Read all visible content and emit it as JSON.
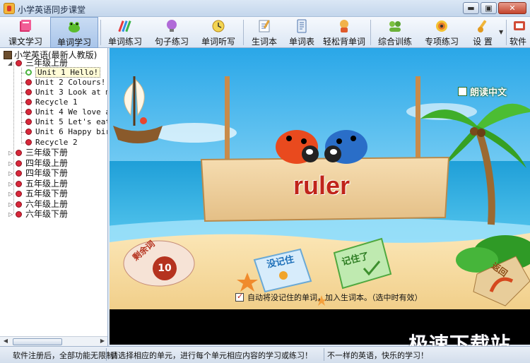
{
  "window": {
    "title": "小学英语同步课堂",
    "buttons": {
      "minimize": "▬",
      "maximize": "▣",
      "close": "✕"
    }
  },
  "toolbar": {
    "items": [
      {
        "label": "课文学习",
        "icon": "book-icon"
      },
      {
        "label": "单词学习",
        "icon": "frog-icon"
      },
      {
        "label": "单词练习",
        "icon": "pencils-icon"
      },
      {
        "label": "句子练习",
        "icon": "bulb-icon"
      },
      {
        "label": "单词听写",
        "icon": "clock-icon"
      },
      {
        "label": "生词本",
        "icon": "notebook-icon"
      },
      {
        "label": "单词表",
        "icon": "wordlist-icon"
      },
      {
        "label": "轻松背单词",
        "icon": "character-icon"
      },
      {
        "label": "综合训练",
        "icon": "people-icon"
      },
      {
        "label": "专项练习",
        "icon": "target-icon"
      },
      {
        "label": "设 置",
        "icon": "settings-icon"
      },
      {
        "label": "软件",
        "icon": "software-icon"
      }
    ],
    "active_index": 1
  },
  "tree": {
    "root": "小学英语(最新人教版)",
    "groups": [
      {
        "label": "三年级上册",
        "expanded": true,
        "units": [
          "Unit 1 Hello!",
          "Unit 2 Colours!",
          "Unit 3 Look at m",
          "Recycle 1",
          "Unit 4 We love a",
          "Unit 5 Let's eat",
          "Unit 6 Happy bir",
          "Recycle 2"
        ]
      },
      {
        "label": "三年级下册"
      },
      {
        "label": "四年级上册"
      },
      {
        "label": "四年级下册"
      },
      {
        "label": "五年级上册"
      },
      {
        "label": "五年级下册"
      },
      {
        "label": "六年级上册"
      },
      {
        "label": "六年级下册"
      }
    ],
    "selected_unit": "Unit 1 Hello!"
  },
  "stage": {
    "word": "ruler",
    "read_chinese_label": "朗读中文",
    "remaining_label": "剩余词",
    "remaining_count": "10",
    "not_remembered_label": "没记住",
    "remembered_label": "记住了",
    "return_label": "返回",
    "auto_add_label": "自动将没记住的单词，加入生词本。（选中时有效）",
    "auto_add_checked": true
  },
  "statusbar": {
    "left": "软件注册后，全部功能无限制！",
    "middle": "请选择相应的单元，进行每个单元相应内容的学习或练习！",
    "right": "不一样的英语，快乐的学习！"
  },
  "watermark": "极速下载站"
}
